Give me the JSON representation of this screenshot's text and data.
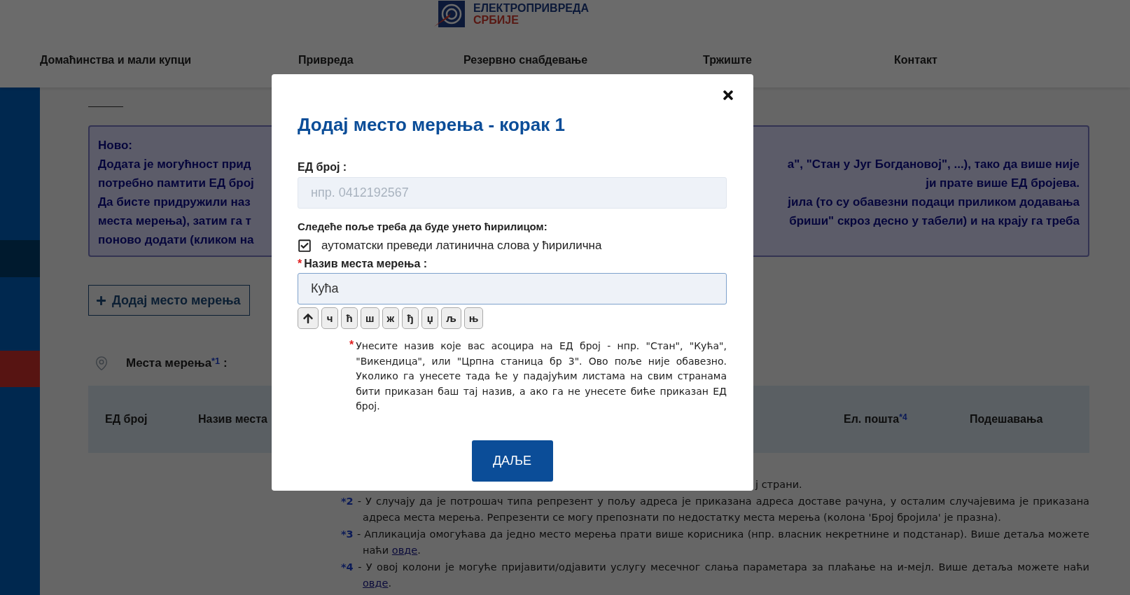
{
  "header": {
    "logo": {
      "line_1": "ЕЛЕКТРОПРИВРЕДА",
      "line_2": "СРБИЈЕ"
    },
    "nav": [
      "Домаћинства и мали купци",
      "Привреда",
      "Резервно снабдевање",
      "Тржиште",
      "Контакт"
    ]
  },
  "notice": {
    "lines": [
      {
        "left": "Ново:"
      },
      {
        "left": "Додата је могућност прид",
        "right": "а\", \"Стан у Југ Богдановој\", ...), тако да више није"
      },
      {
        "left": "потребно памтити ЕД број",
        "right": "ји прате више ЕД бројева."
      },
      {
        "left": "Да бисте придружили наз",
        "right": "јила (то су обавезни подаци приликом додавања"
      },
      {
        "left": "места мерења), затим га т",
        "right": "бриши\" скроз десно у табели) и на крају га треба"
      },
      {
        "left": "поново додати (кликом на"
      }
    ]
  },
  "add_button": "Додај место мерења",
  "places_label": "Места мерења$^{*1}$ :",
  "table": {
    "columns": [
      {
        "label": "ЕД број"
      },
      {
        "label": "Назив места"
      },
      {
        "label": "Ел. пошта$^{*4}$"
      },
      {
        "label": "Подешавања"
      }
    ]
  },
  "footnotes": [
    {
      "text": "ј страни."
    },
    {
      "mark": "*2",
      "text": "- У случају да је потрошач типа репрезент у пољу адреса је приказана адреса доставе рачуна, у осталим случајевима је приказана адреса места мерења. Репрезенти се могу препознати по недостатку места мерења (колона 'Број бројила' је празна)."
    },
    {
      "mark": "*3",
      "text": "- Апликација омогућава да једно место мерења прати више корисника (нпр. власник некретнине и подстанар). Више детаља можете наћи",
      "link": "овде",
      "after": "."
    },
    {
      "mark": "*4",
      "text": "- У овој колони је могуће пријавити/одјавити услугу месечног слања параметара за плаћање на и-мејл. Више детаља можете наћи",
      "link": "овде",
      "after": "."
    }
  ],
  "modal": {
    "title": "Додај место мерења - корак 1",
    "ed_field": {
      "label": "ЕД број :",
      "placeholder": "нпр. 0412192567"
    },
    "cyrillic_notice": "Следеће поље треба да буде унето ћирилицом:",
    "transliterate": {
      "label": "аутоматски преведи латинична слова у ћирилична",
      "checked": true
    },
    "name_field": {
      "required_mark": "*",
      "label": "Назив места мерења :",
      "value": "Кућа"
    },
    "keys": [
      "ч",
      "ћ",
      "ш",
      "ж",
      "ђ",
      "џ",
      "љ",
      "њ"
    ],
    "hint": {
      "mark": "*",
      "text": "Унесите назив које вас асоцира на ЕД број - нпр. \"Стан\", \"Кућа\", \"Викендица\", или \"Црпна станица бр 3\". Ово поље није обавезно. Уколико га унесете тада ће у падајућим листама на свим странама бити приказан баш тај назив, а ако га не унесете биће приказан ЕД број."
    },
    "next_button": "ДАЉЕ"
  }
}
